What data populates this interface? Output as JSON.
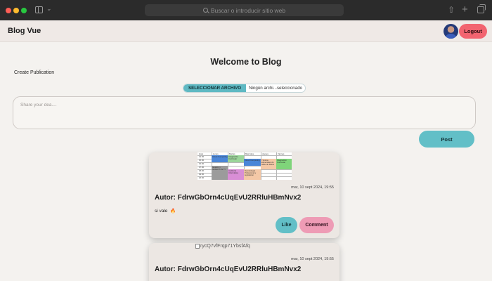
{
  "browser": {
    "url_placeholder": "Buscar o introducir sitio web",
    "icons": [
      "sidebar-icon",
      "chevron-down-icon",
      "search-icon",
      "share-icon",
      "plus-icon",
      "tabs-icon"
    ]
  },
  "header": {
    "brand": "Blog Vue",
    "logout_label": "Logout"
  },
  "main": {
    "welcome": "Welcome to Blog",
    "create_label": "Create Publication",
    "file_button": "SELECCIONAR ARCHIVO",
    "file_status": "Ningún archi...seleccionado",
    "compose_placeholder": "Share your dea....",
    "post_label": "Post"
  },
  "posts": [
    {
      "timestamp": "mar, 10 sept 2024, 19:55",
      "author": "Autor: FdrwGbOrn4cUqEvU2RRluHBmNvx2",
      "text": "si vale",
      "emoji": "🔥",
      "like_label": "Like",
      "comment_label": "Comment",
      "image": {
        "headers": [
          "Hora",
          "Lunes",
          "Martes",
          "Miercoles",
          "Jueves",
          "Viernes"
        ],
        "times": [
          "14:00",
          "15:00",
          "16:00",
          "17:00",
          "18:00",
          "19:00",
          "20:00"
        ],
        "entries": [
          "Cloud Computing",
          "Integración Curricular",
          "Cloud Computing",
          "Tópicos Especiales de base de Datos",
          "Integración Curricular",
          "Gestión y Gobierno de TI",
          "Auditoria Informática",
          "Deontología Profesional y legislacion"
        ]
      }
    },
    {
      "timestamp": "mar, 10 sept 2024, 19:55",
      "author": "Autor: FdrwGbOrn4cUqEvU2RRluHBmNvx2",
      "image_alt": "rycQ7vfFrqp71YbsfAfq"
    }
  ],
  "colors": {
    "accent_teal": "#62bfc7",
    "logout_red": "#f26470",
    "comment_pink": "#ee9bb5",
    "page_bg": "#f4f2ef"
  }
}
